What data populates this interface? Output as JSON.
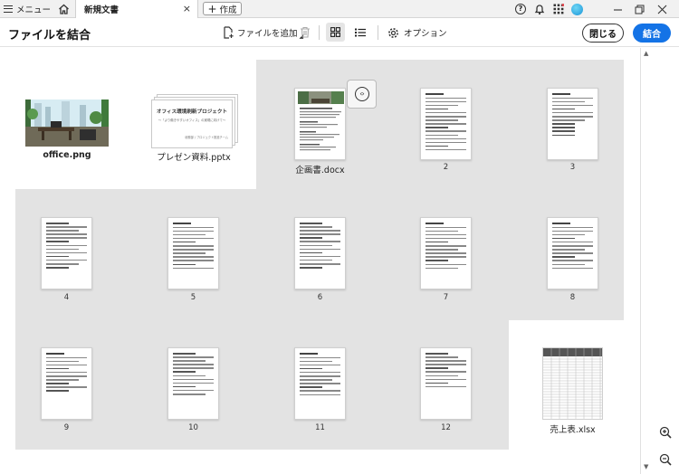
{
  "tabbar": {
    "menu_label": "メニュー",
    "doc_tab_label": "新規文書",
    "doc_tab_close": "×",
    "new_tab_label": "作成"
  },
  "toolbar": {
    "title": "ファイルを結合",
    "add_file_label": "ファイルを追加",
    "options_label": "オプション",
    "close_label": "閉じる",
    "combine_label": "結合"
  },
  "files": {
    "office": "office.png",
    "pptx": "プレゼン資料.pptx",
    "pptx_slide_title": "オフィス環境刷新プロジェクト",
    "pptx_slide_subtitle": "〜「より働きやすいオフィス」の実現に向けて〜",
    "pptx_slide_footer": "総務部 / プロジェクト推進チーム",
    "docx": "企画書.docx",
    "xlsx": "売上表.xlsx"
  },
  "pages": [
    "2",
    "3",
    "4",
    "5",
    "6",
    "7",
    "8",
    "9",
    "10",
    "11",
    "12"
  ],
  "colors": {
    "accent": "#1473e6",
    "group_bg": "#e3e3e3"
  }
}
